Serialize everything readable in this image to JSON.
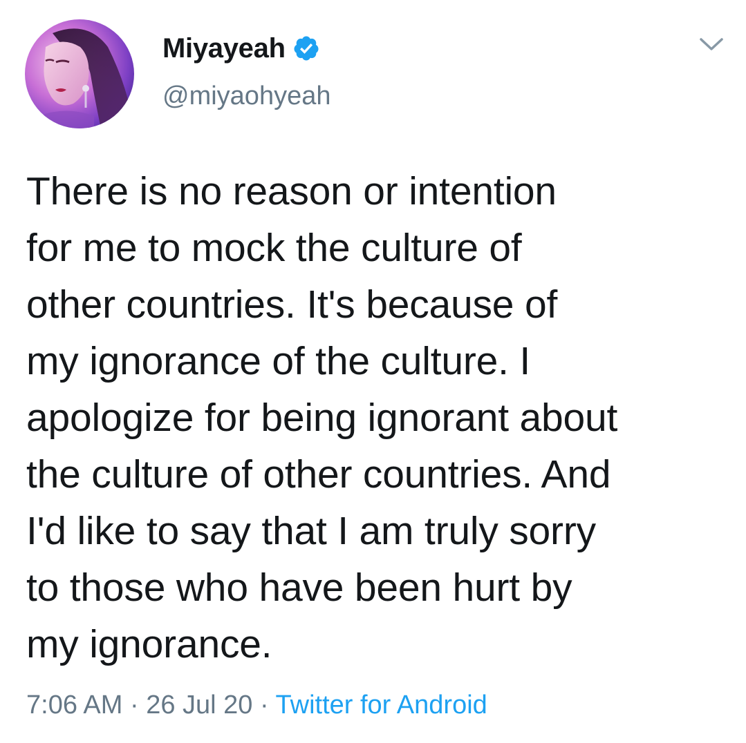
{
  "user": {
    "display_name": "Miyayeah",
    "handle": "@miyaohyeah",
    "verified": true,
    "avatar_icon": "profile-photo"
  },
  "tweet": {
    "text": "There is no reason or intention\nfor me to mock the culture of\nother countries. It's because of\nmy ignorance of the culture. I\napologize for being ignorant about\nthe culture of other countries. And\nI'd like to say that I am truly sorry\nto those who have been hurt by\nmy ignorance."
  },
  "meta": {
    "time": "7:06 AM",
    "separator_1": " · ",
    "date": "26 Jul 20",
    "separator_2": " · ",
    "source": "Twitter for Android"
  },
  "colors": {
    "text": "#14171a",
    "secondary": "#657786",
    "accent": "#1da1f2",
    "background": "#ffffff"
  },
  "icons": {
    "verified": "verified-badge-icon",
    "more": "chevron-down-icon"
  }
}
